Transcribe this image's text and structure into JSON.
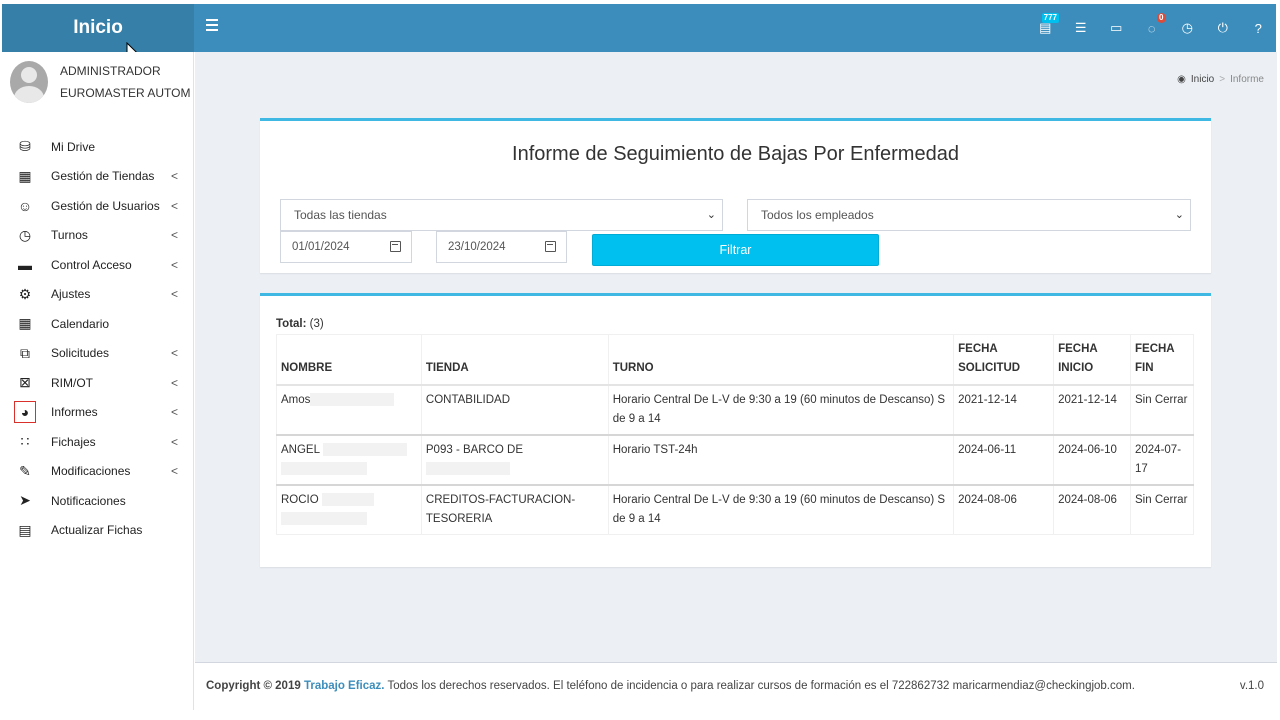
{
  "header": {
    "brand": "Inicio",
    "icons": [
      {
        "name": "notification-inbox-icon",
        "glyph": "▤",
        "badge": "777",
        "badge_color": "#00c0ef"
      },
      {
        "name": "list-icon",
        "glyph": "☰",
        "badge": ""
      },
      {
        "name": "card-icon",
        "glyph": "▭",
        "badge": ""
      },
      {
        "name": "chat-icon",
        "glyph": "◌",
        "badge": "0",
        "badge_color": "#dd4b39"
      },
      {
        "name": "clock-icon",
        "glyph": "◷",
        "badge": ""
      },
      {
        "name": "power-icon",
        "glyph": "⏻",
        "badge": ""
      },
      {
        "name": "help-icon",
        "glyph": "?",
        "badge": ""
      }
    ]
  },
  "user": {
    "name": "ADMINISTRADOR",
    "company": "EUROMASTER AUTOM"
  },
  "sidebar": {
    "items": [
      {
        "label": "Mi Drive",
        "icon": "database-icon",
        "glyph": "⛁",
        "has_submenu": false
      },
      {
        "label": "Gestión de Tiendas",
        "icon": "building-icon",
        "glyph": "▦",
        "has_submenu": true
      },
      {
        "label": "Gestión de Usuarios",
        "icon": "smile-icon",
        "glyph": "☺",
        "has_submenu": true
      },
      {
        "label": "Turnos",
        "icon": "clock-icon",
        "glyph": "◷",
        "has_submenu": true
      },
      {
        "label": "Control Acceso",
        "icon": "credit-card-icon",
        "glyph": "▬",
        "has_submenu": true
      },
      {
        "label": "Ajustes",
        "icon": "gear-icon",
        "glyph": "⚙",
        "has_submenu": true
      },
      {
        "label": "Calendario",
        "icon": "calendar-icon",
        "glyph": "▦",
        "has_submenu": false
      },
      {
        "label": "Solicitudes",
        "icon": "clone-icon",
        "glyph": "⧉",
        "has_submenu": true
      },
      {
        "label": "RIM/OT",
        "icon": "calendar-x-icon",
        "glyph": "⊠",
        "has_submenu": true
      },
      {
        "label": "Informes",
        "icon": "pie-chart-icon",
        "glyph": "◕",
        "has_submenu": true,
        "highlighted": true
      },
      {
        "label": "Fichajes",
        "icon": "grid-icon",
        "glyph": "∷",
        "has_submenu": true
      },
      {
        "label": "Modificaciones",
        "icon": "edit-icon",
        "glyph": "✎",
        "has_submenu": true
      },
      {
        "label": "Notificaciones",
        "icon": "send-icon",
        "glyph": "➤",
        "has_submenu": false
      },
      {
        "label": "Actualizar Fichas",
        "icon": "file-icon",
        "glyph": "▤",
        "has_submenu": false
      }
    ],
    "chevron": "<"
  },
  "breadcrumb": {
    "home": "Inicio",
    "separator": ">",
    "current": "Informe"
  },
  "report": {
    "title": "Informe de Seguimiento de Bajas Por Enfermedad",
    "store_select": "Todas las tiendas",
    "employee_select": "Todos los empleados",
    "date_from": "01/01/2024",
    "date_to": "23/10/2024",
    "filter_button": "Filtrar"
  },
  "results": {
    "total_label": "Total:",
    "total_value": "(3)",
    "columns": [
      "NOMBRE",
      "TIENDA",
      "TURNO",
      "FECHA SOLICITUD",
      "FECHA INICIO",
      "FECHA FIN"
    ],
    "rows": [
      {
        "nombre": "Amos",
        "tienda": "CONTABILIDAD",
        "turno": "Horario Central De L-V de 9:30 a 19 (60 minutos de Descanso) S de 9 a 14",
        "fecha_solicitud": "2021-12-14",
        "fecha_inicio": "2021-12-14",
        "fecha_fin": "Sin Cerrar"
      },
      {
        "nombre": "ANGEL",
        "tienda": "P093 - BARCO DE",
        "turno": "Horario TST-24h",
        "fecha_solicitud": "2024-06-11",
        "fecha_inicio": "2024-06-10",
        "fecha_fin": "2024-07-17"
      },
      {
        "nombre": "ROCIO",
        "tienda": "CREDITOS-FACTURACION-TESORERIA",
        "turno": "Horario Central De L-V de 9:30 a 19 (60 minutos de Descanso) S de 9 a 14",
        "fecha_solicitud": "2024-08-06",
        "fecha_inicio": "2024-08-06",
        "fecha_fin": "Sin Cerrar"
      }
    ]
  },
  "footer": {
    "copyright": "Copyright © 2019",
    "company_link": "Trabajo Eficaz.",
    "text": "Todos los derechos reservados. El teléfono de incidencia o para realizar cursos de formación es el 722862732 maricarmendiaz@checkingjob.com.",
    "version": "v.1.0"
  },
  "colors": {
    "header": "#3c8dbc",
    "brand": "#367fa9",
    "accent": "#00c0ef",
    "box_border": "#3fb8e3",
    "content_bg": "#ecf0f5"
  }
}
